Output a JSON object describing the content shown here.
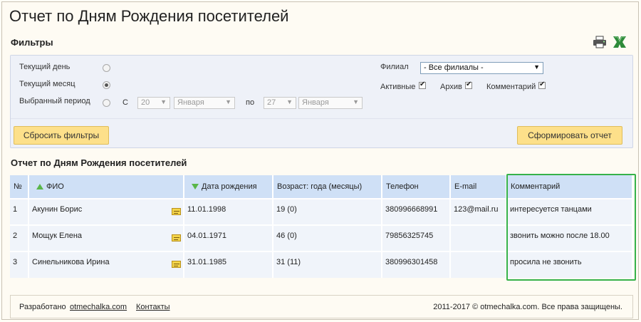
{
  "page": {
    "title": "Отчет по Дням Рождения посетителей"
  },
  "filters": {
    "title": "Фильтры",
    "current_day_label": "Текущий день",
    "current_month_label": "Текущий месяц",
    "period_label": "Выбранный период",
    "from_label": "С",
    "to_label": "по",
    "from_day": "20",
    "from_month": "Января",
    "to_day": "27",
    "to_month": "Января",
    "branch_label": "Филиал",
    "branch_value": "- Все филиалы -",
    "active_label": "Активные",
    "archive_label": "Архив",
    "comment_label": "Комментарий",
    "reset_button": "Сбросить фильтры",
    "generate_button": "Сформировать отчет"
  },
  "report": {
    "title": "Отчет по Дням Рождения посетителей",
    "columns": [
      "№",
      "ФИО",
      "Дата рождения",
      "Возраст: года (месяцы)",
      "Телефон",
      "E-mail",
      "Комментарий"
    ],
    "rows": [
      {
        "num": "1",
        "name": "Акунин Борис",
        "birth": "11.01.1998",
        "age": "19 (0)",
        "phone": "380996668991",
        "email": "123@mail.ru",
        "comment": "интересуется танцами"
      },
      {
        "num": "2",
        "name": "Мощук Елена",
        "birth": "04.01.1971",
        "age": "46 (0)",
        "phone": "79856325745",
        "email": "",
        "comment": "звонить можно после 18.00"
      },
      {
        "num": "3",
        "name": "Синельникова Ирина",
        "birth": "31.01.1985",
        "age": "31 (11)",
        "phone": "380996301458",
        "email": "",
        "comment": "просила не звонить"
      }
    ]
  },
  "footer": {
    "developed_by": "Разработано",
    "site_link": "otmechalka.com",
    "contacts_link": "Контакты",
    "copyright": "2011-2017 © otmechalka.com. Все права защищены."
  },
  "colors": {
    "accent_button": "#fde08a",
    "header": "#cfe0f6",
    "highlight": "#36b24a",
    "sort_arrow": "#59b64a"
  },
  "icons": {
    "print": "printer-icon",
    "excel": "excel-icon",
    "note": "note-icon"
  }
}
